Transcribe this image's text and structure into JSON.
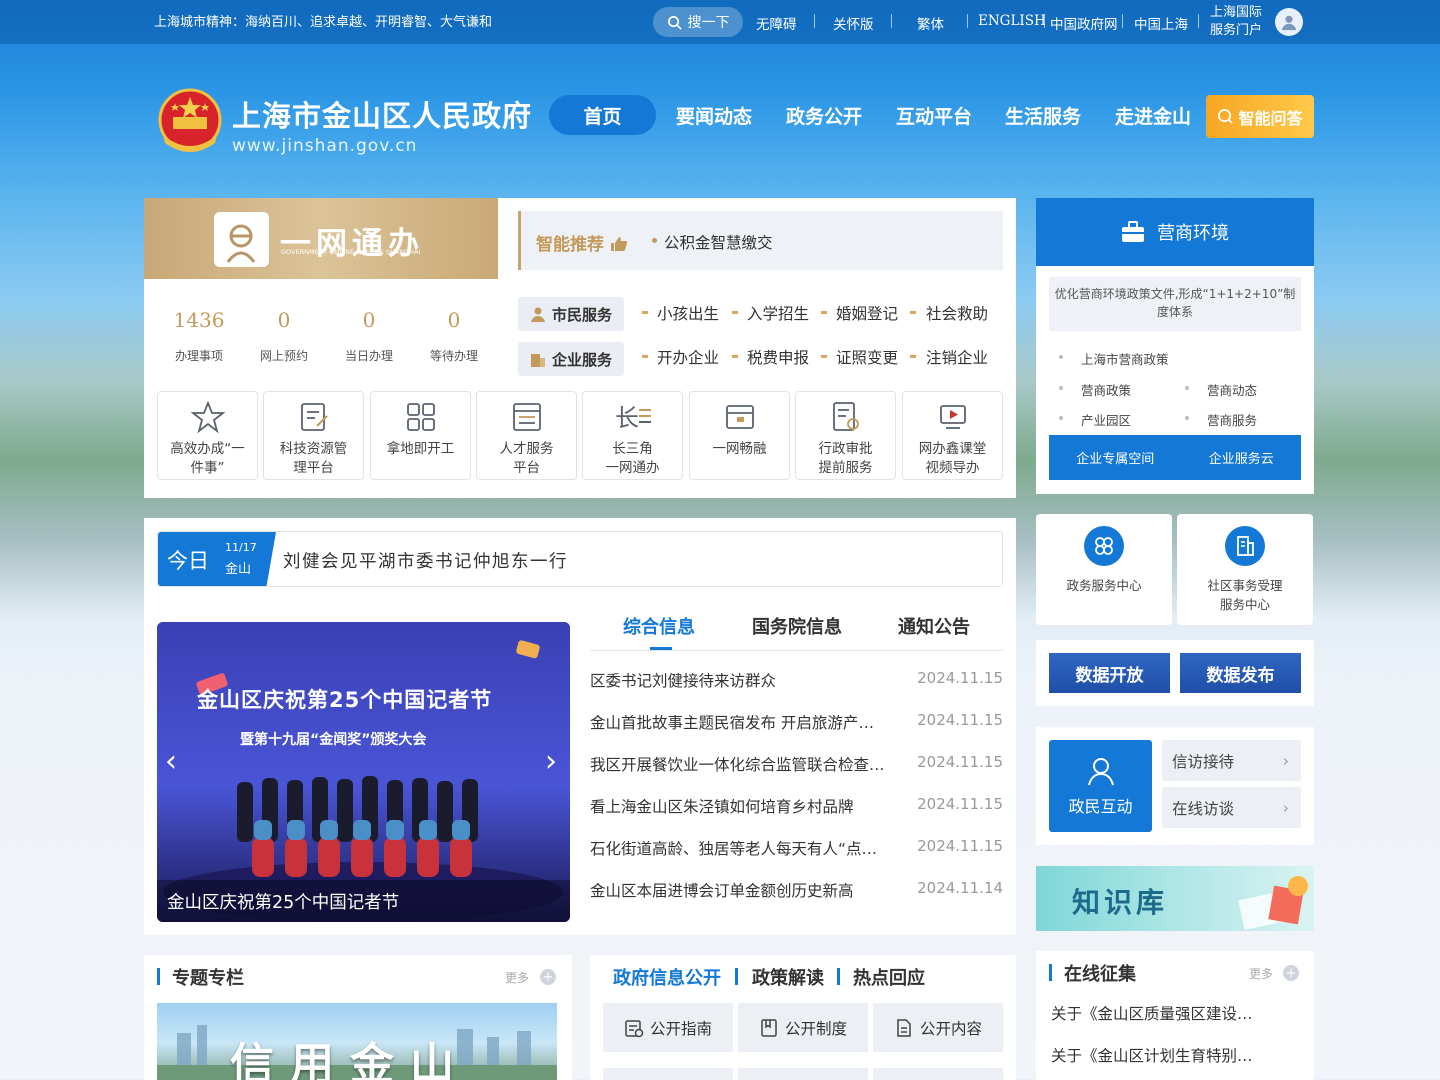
{
  "topbar": {
    "motto": "上海城市精神：海纳百川、追求卓越、开明睿智、大气谦和",
    "search_label": "搜一下",
    "links": [
      "无障碍",
      "关怀版",
      "繁体",
      "ENGLISH",
      "中国政府网",
      "中国上海"
    ],
    "portal_line1": "上海国际",
    "portal_line2": "服务门户"
  },
  "header": {
    "title": "上海市金山区人民政府",
    "url": "www.jinshan.gov.cn",
    "nav": [
      "首页",
      "要闻动态",
      "政务公开",
      "互动平台",
      "生活服务",
      "走进金山"
    ],
    "ai_button": "智能问答"
  },
  "onestop": {
    "title": "一网通办",
    "subtitle": "GOVERNMENT ONLINE-OFFLINE SHANGHAI",
    "recommend_label": "智能推荐",
    "recommend_items": [
      "公积金智慧缴交"
    ],
    "stats": [
      {
        "value": "1436",
        "label": "办理事项"
      },
      {
        "value": "0",
        "label": "网上预约"
      },
      {
        "value": "0",
        "label": "当日办理"
      },
      {
        "value": "0",
        "label": "等待办理"
      }
    ],
    "citizen_label": "市民服务",
    "citizen_links": [
      "小孩出生",
      "入学招生",
      "婚姻登记",
      "社会救助"
    ],
    "enterprise_label": "企业服务",
    "enterprise_links": [
      "开办企业",
      "税费申报",
      "证照变更",
      "注销企业"
    ],
    "tiles": [
      {
        "label": "高效办成“一\n件事”",
        "icon": "star-icon"
      },
      {
        "label": "科技资源管\n理平台",
        "icon": "edit-doc-icon"
      },
      {
        "label": "拿地即开工",
        "icon": "grid-icon"
      },
      {
        "label": "人才服务\n平台",
        "icon": "list-doc-icon"
      },
      {
        "label": "长三角\n一网通办",
        "icon": "yangtze-icon"
      },
      {
        "label": "一网畅融",
        "icon": "wallet-icon"
      },
      {
        "label": "行政审批\n提前服务",
        "icon": "approval-icon"
      },
      {
        "label": "网办鑫课堂\n视频导办",
        "icon": "video-icon"
      }
    ]
  },
  "business": {
    "title": "营商环境",
    "note": "优化营商环境政策文件,形成“1+1+2+10”制度体系",
    "links": [
      "上海市营商政策",
      "营商政策",
      "营商动态",
      "产业园区",
      "营商服务"
    ],
    "buttons": [
      "企业专属空间",
      "企业服务云"
    ]
  },
  "centers": [
    {
      "label": "政务服务中心",
      "icon": "flower-icon"
    },
    {
      "label": "社区事务受理\n服务中心",
      "icon": "building-icon"
    }
  ],
  "data_buttons": [
    "数据开放",
    "数据发布"
  ],
  "interaction": {
    "main": "政民互动",
    "links": [
      "信访接待",
      "在线访谈"
    ]
  },
  "knowledge": {
    "title": "知识库"
  },
  "today": {
    "word": "今日",
    "date": "11/17",
    "location": "金山",
    "headline": "刘健会见平湖市委书记仲旭东一行"
  },
  "photo": {
    "banner_line1": "金山区庆祝第25个中国记者节",
    "banner_line2": "暨第十九届“金闻奖”颁奖大会",
    "caption": "金山区庆祝第25个中国记者节"
  },
  "news": {
    "tabs": [
      "综合信息",
      "国务院信息",
      "通知公告"
    ],
    "items": [
      {
        "title": "区委书记刘健接待来访群众",
        "date": "2024.11.15"
      },
      {
        "title": "金山首批故事主题民宿发布 开启旅游产业新篇章",
        "date": "2024.11.15"
      },
      {
        "title": "我区开展餐饮业一体化综合监管联合检查行动",
        "date": "2024.11.15"
      },
      {
        "title": "看上海金山区朱泾镇如何培育乡村品牌",
        "date": "2024.11.15"
      },
      {
        "title": "石化街道高龄、独居等老人每天有人“点对点”关爱",
        "date": "2024.11.15"
      },
      {
        "title": "金山区本届进博会订单金额创历史新高",
        "date": "2024.11.14"
      }
    ]
  },
  "topics": {
    "title": "专题专栏",
    "more": "更多",
    "banner": "信用金山"
  },
  "gov_info": {
    "tabs": [
      "政府信息公开",
      "政策解读",
      "热点回应"
    ],
    "buttons": [
      "公开指南",
      "公开制度",
      "公开内容"
    ]
  },
  "solicit": {
    "title": "在线征集",
    "more": "更多",
    "items": [
      "关于《金山区质量强区建设…",
      "关于《金山区计划生育特别…"
    ]
  },
  "colors": {
    "primary": "#1478d6",
    "gold": "#c49a5c",
    "accent_orange": "#f6a623"
  }
}
